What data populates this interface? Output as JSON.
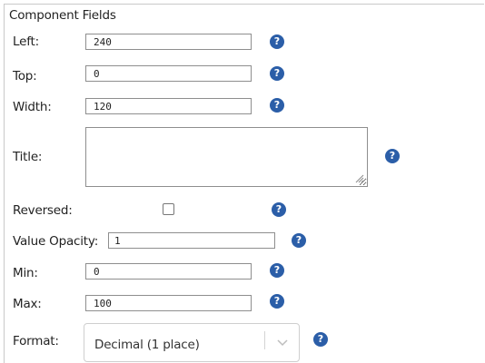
{
  "panel": {
    "title": "Component Fields"
  },
  "fields": {
    "left": {
      "label": "Left:",
      "value": "240"
    },
    "top": {
      "label": "Top:",
      "value": "0"
    },
    "width": {
      "label": "Width:",
      "value": "120"
    },
    "title": {
      "label": "Title:",
      "value": ""
    },
    "reversed": {
      "label": "Reversed:",
      "checked": false
    },
    "value_opacity": {
      "label": "Value Opacity:",
      "value": "1"
    },
    "min": {
      "label": "Min:",
      "value": "0"
    },
    "max": {
      "label": "Max:",
      "value": "100"
    },
    "format": {
      "label": "Format:",
      "selected": "Decimal (1 place)"
    }
  },
  "help": {
    "glyph": "?",
    "icon": "question-circle-icon",
    "color": "#2b5ea8"
  }
}
